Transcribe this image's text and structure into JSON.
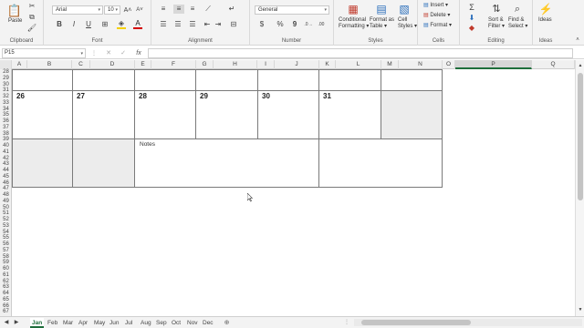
{
  "ribbon": {
    "clipboard": {
      "paste": "Paste",
      "label": "Clipboard"
    },
    "font": {
      "name": "Arial",
      "size": "10",
      "label": "Font",
      "bold": "B",
      "italic": "I",
      "underline": "U"
    },
    "alignment": {
      "label": "Alignment"
    },
    "number": {
      "format": "General",
      "label": "Number",
      "currency": "$",
      "percent": "%",
      "comma": "9"
    },
    "styles": {
      "conditional_line1": "Conditional",
      "conditional_line2": "Formatting",
      "format_table_line1": "Format as",
      "format_table_line2": "Table",
      "cell_styles_line1": "Cell",
      "cell_styles_line2": "Styles",
      "label": "Styles"
    },
    "cells": {
      "insert": "Insert",
      "delete": "Delete",
      "format": "Format",
      "label": "Cells"
    },
    "editing": {
      "sum": "Σ",
      "sort_line1": "Sort &",
      "sort_line2": "Filter",
      "find_line1": "Find &",
      "find_line2": "Select",
      "label": "Editing"
    },
    "ideas": {
      "button": "Ideas",
      "label": "Ideas"
    }
  },
  "formula_bar": {
    "name_box": "P15",
    "fx": "fx",
    "value": ""
  },
  "columns": [
    "A",
    "B",
    "C",
    "D",
    "E",
    "F",
    "G",
    "H",
    "I",
    "J",
    "K",
    "L",
    "M",
    "N",
    "O",
    "P",
    "Q"
  ],
  "rows": [
    "28",
    "29",
    "30",
    "31",
    "32",
    "33",
    "34",
    "35",
    "36",
    "37",
    "38",
    "39",
    "40",
    "41",
    "42",
    "43",
    "44",
    "45",
    "46",
    "47",
    "48",
    "49",
    "50",
    "51",
    "52",
    "53",
    "54",
    "55",
    "56",
    "57",
    "58",
    "59",
    "60",
    "61",
    "62",
    "63",
    "64",
    "65",
    "66",
    "67"
  ],
  "calendar": {
    "days": [
      "26",
      "27",
      "28",
      "29",
      "30",
      "31"
    ],
    "notes_label": "Notes"
  },
  "sheet_tabs": [
    "Jan",
    "Feb",
    "Mar",
    "Apr",
    "May",
    "Jun",
    "Jul",
    "Aug",
    "Sep",
    "Oct",
    "Nov",
    "Dec"
  ],
  "active_tab": "Jan",
  "colors": {
    "accent": "#1e6e3b",
    "gray_cell": "#ececec"
  }
}
